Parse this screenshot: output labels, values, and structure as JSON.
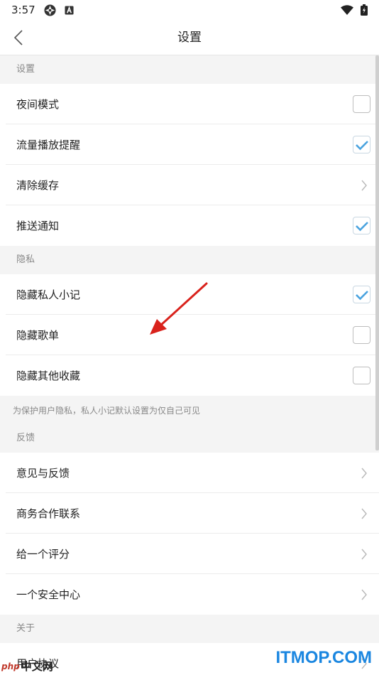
{
  "status_bar": {
    "time": "3:57",
    "icons": [
      "pinwheel-icon",
      "a-box-icon",
      "wifi-icon",
      "battery-charging-icon"
    ]
  },
  "header": {
    "title": "设置",
    "back_icon": "chevron-left-icon"
  },
  "sections": [
    {
      "title": "设置",
      "rows": [
        {
          "label": "夜间模式",
          "control": "checkbox",
          "checked": false
        },
        {
          "label": "流量播放提醒",
          "control": "checkbox",
          "checked": true
        },
        {
          "label": "清除缓存",
          "control": "chevron"
        },
        {
          "label": "推送通知",
          "control": "checkbox",
          "checked": true
        }
      ]
    },
    {
      "title": "隐私",
      "rows": [
        {
          "label": "隐藏私人小记",
          "control": "checkbox",
          "checked": true
        },
        {
          "label": "隐藏歌单",
          "control": "checkbox",
          "checked": false
        },
        {
          "label": "隐藏其他收藏",
          "control": "checkbox",
          "checked": false
        }
      ],
      "note": "为保护用户隐私，私人小记默认设置为仅自己可见"
    },
    {
      "title": "反馈",
      "rows": [
        {
          "label": "意见与反馈",
          "control": "chevron"
        },
        {
          "label": "商务合作联系",
          "control": "chevron"
        },
        {
          "label": "给一个评分",
          "control": "chevron"
        },
        {
          "label": "一个安全中心",
          "control": "chevron"
        }
      ]
    },
    {
      "title": "关于",
      "rows": [
        {
          "label": "用户协议",
          "control": "chevron"
        }
      ]
    }
  ],
  "colors": {
    "check": "#4aa3df",
    "arrow": "#d9221c",
    "watermark_blue": "#1a86e0"
  },
  "watermarks": {
    "left_php": "php",
    "left_text": "中文网",
    "right": "ITMOP.COM"
  }
}
